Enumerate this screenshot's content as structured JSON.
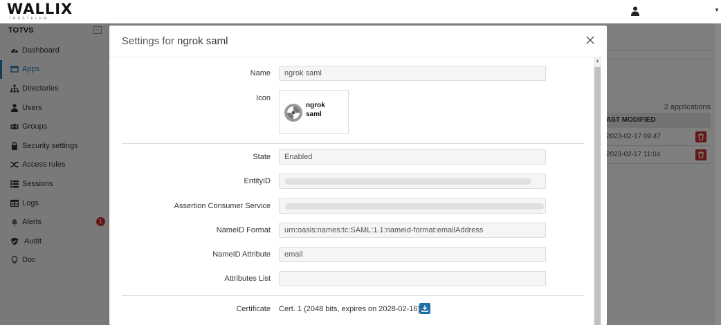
{
  "header": {
    "logo_text": "WALLIX",
    "logo_sub": "TRUSTELEM",
    "user_icon": "user-icon"
  },
  "sidebar": {
    "org": "TOTVS",
    "collapse_label": "−",
    "items": [
      {
        "label": "Dashboard",
        "icon": "dashboard-icon"
      },
      {
        "label": "Apps",
        "icon": "apps-icon",
        "active": true
      },
      {
        "label": "Directories",
        "icon": "sitemap-icon"
      },
      {
        "label": "Users",
        "icon": "user-icon"
      },
      {
        "label": "Groups",
        "icon": "users-icon"
      },
      {
        "label": "Security settings",
        "icon": "lock-icon"
      },
      {
        "label": "Access rules",
        "icon": "random-icon"
      },
      {
        "label": "Sessions",
        "icon": "list-icon"
      },
      {
        "label": "Logs",
        "icon": "table-icon"
      },
      {
        "label": "Alerts",
        "icon": "bell-icon",
        "badge": "1"
      },
      {
        "label": "Audit",
        "icon": "shield-icon"
      },
      {
        "label": "Doc",
        "icon": "lightbulb-icon"
      }
    ]
  },
  "background": {
    "app_count": "2 applications",
    "column_last_modified": "AST MODIFIED",
    "rows": [
      {
        "modified": "2023-02-17 09:47"
      },
      {
        "modified": "2023-02-17 11:04"
      }
    ]
  },
  "modal": {
    "title_prefix": "Settings for",
    "title_name": "ngrok saml",
    "close_label": "×",
    "fields": {
      "name_label": "Name",
      "name_value": "ngrok saml",
      "icon_label": "Icon",
      "icon_text_line1": "ngrok",
      "icon_text_line2": "saml",
      "state_label": "State",
      "state_value": "Enabled",
      "entityid_label": "EntityID",
      "acs_label": "Assertion Consumer Service",
      "nameid_format_label": "NameID Format",
      "nameid_format_value": "urn:oasis:names:tc:SAML:1.1:nameid-format:emailAddress",
      "nameid_attr_label": "NameID Attribute",
      "nameid_attr_value": "email",
      "attrs_list_label": "Attributes List",
      "attrs_list_value": "",
      "certificate_label": "Certificate",
      "certificate_value": "Cert. 1 (2048 bits, expires on 2028-02-16)"
    }
  },
  "colors": {
    "accent": "#2a7ab0",
    "danger": "#c9302c",
    "download": "#1d6fa5"
  }
}
